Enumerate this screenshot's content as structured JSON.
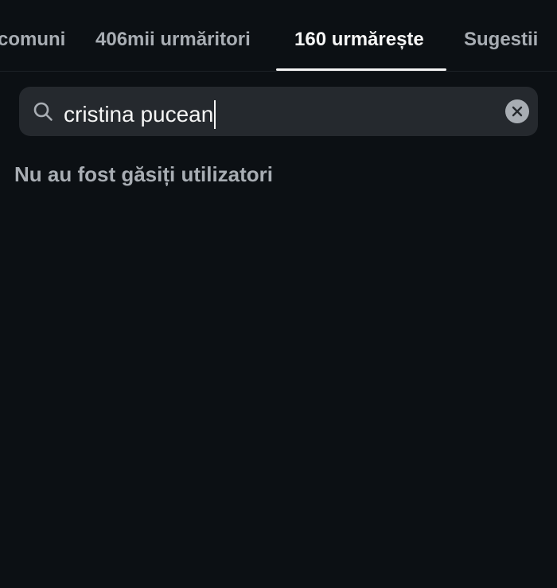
{
  "tabs": [
    {
      "label": "comuni",
      "active": false
    },
    {
      "label": "406mii urmăritori",
      "active": false
    },
    {
      "label": "160 urmărește",
      "active": true
    },
    {
      "label": "Sugestii",
      "active": false
    }
  ],
  "search": {
    "value": "cristina pucean",
    "icon": "search-icon",
    "clear_icon": "close-icon"
  },
  "results": {
    "empty_message": "Nu au fost găsiți utilizatori"
  },
  "colors": {
    "background": "#0c1014",
    "search_background": "#25292e",
    "text_primary": "#f5f5f5",
    "text_secondary": "#a8adb3"
  }
}
